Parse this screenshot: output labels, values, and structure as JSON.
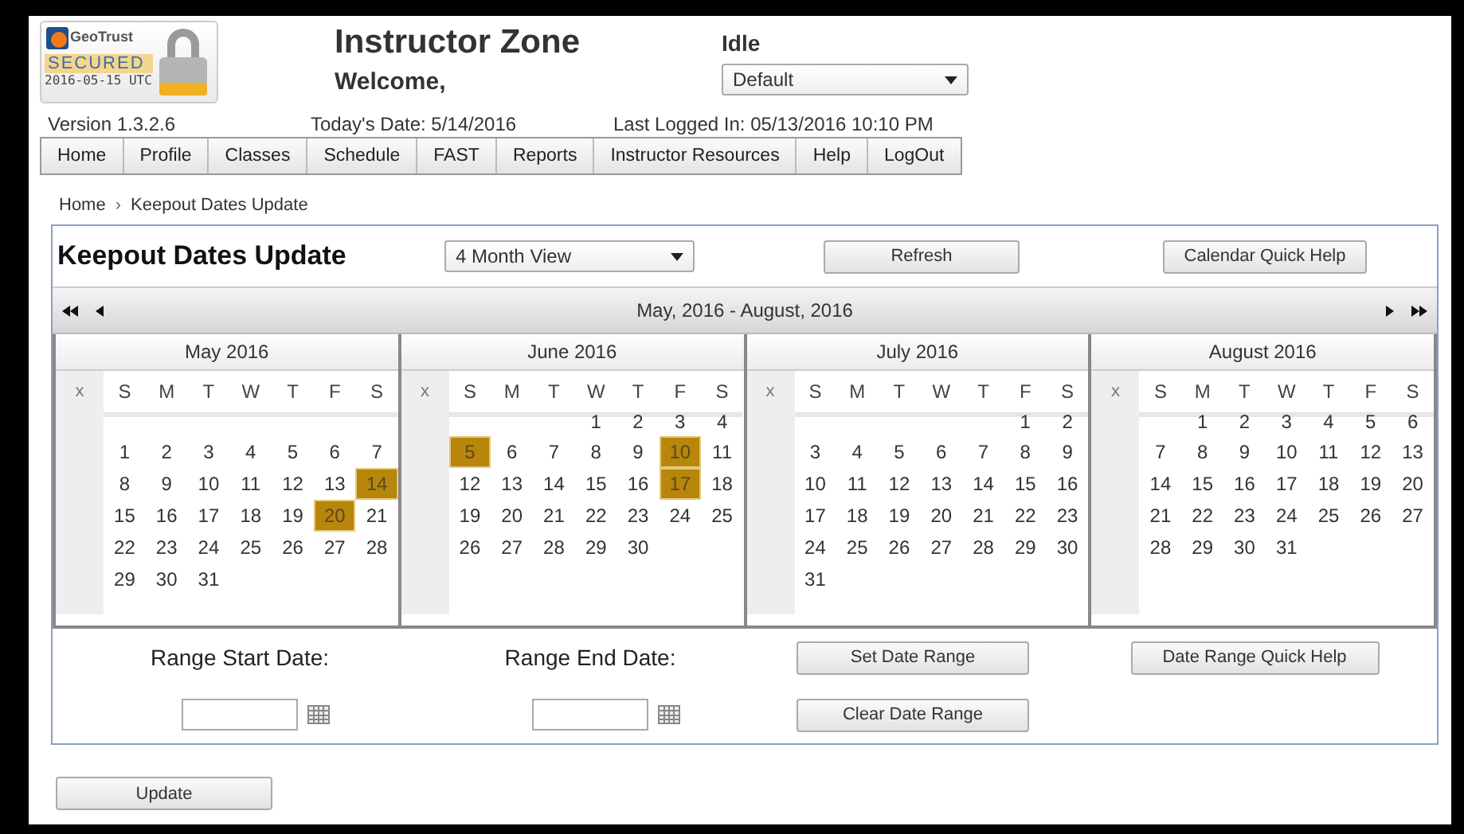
{
  "seal": {
    "brand": "GeoTrust",
    "label": "SECURED",
    "date": "2016-05-15 UTC"
  },
  "app_title": "Instructor Zone",
  "welcome": "Welcome,",
  "status": "Idle",
  "profile_select": {
    "value": "Default"
  },
  "info": {
    "version": "Version 1.3.2.6",
    "today_label": "Today's Date:",
    "today": "5/14/2016",
    "last_label": "Last Logged In:",
    "last": "05/13/2016 10:10 PM"
  },
  "nav": [
    "Home",
    "Profile",
    "Classes",
    "Schedule",
    "FAST",
    "Reports",
    "Instructor Resources",
    "Help",
    "LogOut"
  ],
  "breadcrumb": {
    "items": [
      "Home",
      "Keepout Dates Update"
    ],
    "separator": "›"
  },
  "page_title": "Keepout Dates Update",
  "view_select": {
    "value": "4 Month View"
  },
  "top_buttons": [
    "Refresh",
    "Calendar Quick Help"
  ],
  "calendar": {
    "range": "May, 2016 - August, 2016",
    "months": [
      {
        "title": "May 2016",
        "week_header": "x",
        "weekdays": [
          "S",
          "M",
          "T",
          "W",
          "T",
          "F",
          "S"
        ],
        "weeks": [
          [
            {
              "kind": "blank"
            },
            {
              "kind": "blank"
            },
            {
              "kind": "blank"
            },
            {
              "kind": "blank"
            },
            {
              "kind": "blank"
            },
            {
              "kind": "blank"
            },
            {
              "kind": "blank"
            }
          ],
          [
            {
              "kind": "day",
              "label": "1",
              "selected": false
            },
            {
              "kind": "day",
              "label": "2",
              "selected": false
            },
            {
              "kind": "day",
              "label": "3",
              "selected": false
            },
            {
              "kind": "day",
              "label": "4",
              "selected": false
            },
            {
              "kind": "day",
              "label": "5",
              "selected": false
            },
            {
              "kind": "day",
              "label": "6",
              "selected": false
            },
            {
              "kind": "day",
              "label": "7",
              "selected": false
            }
          ],
          [
            {
              "kind": "day",
              "label": "8",
              "selected": false
            },
            {
              "kind": "day",
              "label": "9",
              "selected": false
            },
            {
              "kind": "day",
              "label": "10",
              "selected": false
            },
            {
              "kind": "day",
              "label": "11",
              "selected": false
            },
            {
              "kind": "day",
              "label": "12",
              "selected": false
            },
            {
              "kind": "day",
              "label": "13",
              "selected": false
            },
            {
              "kind": "day",
              "label": "14",
              "selected": true
            }
          ],
          [
            {
              "kind": "day",
              "label": "15",
              "selected": false
            },
            {
              "kind": "day",
              "label": "16",
              "selected": false
            },
            {
              "kind": "day",
              "label": "17",
              "selected": false
            },
            {
              "kind": "day",
              "label": "18",
              "selected": false
            },
            {
              "kind": "day",
              "label": "19",
              "selected": false
            },
            {
              "kind": "day",
              "label": "20",
              "selected": true
            },
            {
              "kind": "day",
              "label": "21",
              "selected": false
            }
          ],
          [
            {
              "kind": "day",
              "label": "22",
              "selected": false
            },
            {
              "kind": "day",
              "label": "23",
              "selected": false
            },
            {
              "kind": "day",
              "label": "24",
              "selected": false
            },
            {
              "kind": "day",
              "label": "25",
              "selected": false
            },
            {
              "kind": "day",
              "label": "26",
              "selected": false
            },
            {
              "kind": "day",
              "label": "27",
              "selected": false
            },
            {
              "kind": "day",
              "label": "28",
              "selected": false
            }
          ],
          [
            {
              "kind": "day",
              "label": "29",
              "selected": false
            },
            {
              "kind": "day",
              "label": "30",
              "selected": false
            },
            {
              "kind": "day",
              "label": "31",
              "selected": false
            }
          ]
        ]
      },
      {
        "title": "June 2016",
        "week_header": "x",
        "weekdays": [
          "S",
          "M",
          "T",
          "W",
          "T",
          "F",
          "S"
        ],
        "weeks": [
          [
            {
              "kind": "blank"
            },
            {
              "kind": "blank"
            },
            {
              "kind": "blank"
            },
            {
              "kind": "day",
              "label": "1",
              "selected": false
            },
            {
              "kind": "day",
              "label": "2",
              "selected": false
            },
            {
              "kind": "day",
              "label": "3",
              "selected": false
            },
            {
              "kind": "day",
              "label": "4",
              "selected": false
            }
          ],
          [
            {
              "kind": "day",
              "label": "5",
              "selected": true
            },
            {
              "kind": "day",
              "label": "6",
              "selected": false
            },
            {
              "kind": "day",
              "label": "7",
              "selected": false
            },
            {
              "kind": "day",
              "label": "8",
              "selected": false
            },
            {
              "kind": "day",
              "label": "9",
              "selected": false
            },
            {
              "kind": "day",
              "label": "10",
              "selected": true
            },
            {
              "kind": "day",
              "label": "11",
              "selected": false
            }
          ],
          [
            {
              "kind": "day",
              "label": "12",
              "selected": false
            },
            {
              "kind": "day",
              "label": "13",
              "selected": false
            },
            {
              "kind": "day",
              "label": "14",
              "selected": false
            },
            {
              "kind": "day",
              "label": "15",
              "selected": false
            },
            {
              "kind": "day",
              "label": "16",
              "selected": false
            },
            {
              "kind": "day",
              "label": "17",
              "selected": true
            },
            {
              "kind": "day",
              "label": "18",
              "selected": false
            }
          ],
          [
            {
              "kind": "day",
              "label": "19",
              "selected": false
            },
            {
              "kind": "day",
              "label": "20",
              "selected": false
            },
            {
              "kind": "day",
              "label": "21",
              "selected": false
            },
            {
              "kind": "day",
              "label": "22",
              "selected": false
            },
            {
              "kind": "day",
              "label": "23",
              "selected": false
            },
            {
              "kind": "day",
              "label": "24",
              "selected": false
            },
            {
              "kind": "day",
              "label": "25",
              "selected": false
            }
          ],
          [
            {
              "kind": "day",
              "label": "26",
              "selected": false
            },
            {
              "kind": "day",
              "label": "27",
              "selected": false
            },
            {
              "kind": "day",
              "label": "28",
              "selected": false
            },
            {
              "kind": "day",
              "label": "29",
              "selected": false
            },
            {
              "kind": "day",
              "label": "30",
              "selected": false
            }
          ]
        ]
      },
      {
        "title": "July 2016",
        "week_header": "x",
        "weekdays": [
          "S",
          "M",
          "T",
          "W",
          "T",
          "F",
          "S"
        ],
        "weeks": [
          [
            {
              "kind": "blank"
            },
            {
              "kind": "blank"
            },
            {
              "kind": "blank"
            },
            {
              "kind": "blank"
            },
            {
              "kind": "blank"
            },
            {
              "kind": "day",
              "label": "1",
              "selected": false
            },
            {
              "kind": "day",
              "label": "2",
              "selected": false
            }
          ],
          [
            {
              "kind": "day",
              "label": "3",
              "selected": false
            },
            {
              "kind": "day",
              "label": "4",
              "selected": false
            },
            {
              "kind": "day",
              "label": "5",
              "selected": false
            },
            {
              "kind": "day",
              "label": "6",
              "selected": false
            },
            {
              "kind": "day",
              "label": "7",
              "selected": false
            },
            {
              "kind": "day",
              "label": "8",
              "selected": false
            },
            {
              "kind": "day",
              "label": "9",
              "selected": false
            }
          ],
          [
            {
              "kind": "day",
              "label": "10",
              "selected": false
            },
            {
              "kind": "day",
              "label": "11",
              "selected": false
            },
            {
              "kind": "day",
              "label": "12",
              "selected": false
            },
            {
              "kind": "day",
              "label": "13",
              "selected": false
            },
            {
              "kind": "day",
              "label": "14",
              "selected": false
            },
            {
              "kind": "day",
              "label": "15",
              "selected": false
            },
            {
              "kind": "day",
              "label": "16",
              "selected": false
            }
          ],
          [
            {
              "kind": "day",
              "label": "17",
              "selected": false
            },
            {
              "kind": "day",
              "label": "18",
              "selected": false
            },
            {
              "kind": "day",
              "label": "19",
              "selected": false
            },
            {
              "kind": "day",
              "label": "20",
              "selected": false
            },
            {
              "kind": "day",
              "label": "21",
              "selected": false
            },
            {
              "kind": "day",
              "label": "22",
              "selected": false
            },
            {
              "kind": "day",
              "label": "23",
              "selected": false
            }
          ],
          [
            {
              "kind": "day",
              "label": "24",
              "selected": false
            },
            {
              "kind": "day",
              "label": "25",
              "selected": false
            },
            {
              "kind": "day",
              "label": "26",
              "selected": false
            },
            {
              "kind": "day",
              "label": "27",
              "selected": false
            },
            {
              "kind": "day",
              "label": "28",
              "selected": false
            },
            {
              "kind": "day",
              "label": "29",
              "selected": false
            },
            {
              "kind": "day",
              "label": "30",
              "selected": false
            }
          ],
          [
            {
              "kind": "day",
              "label": "31",
              "selected": false
            }
          ]
        ]
      },
      {
        "title": "August 2016",
        "week_header": "x",
        "weekdays": [
          "S",
          "M",
          "T",
          "W",
          "T",
          "F",
          "S"
        ],
        "weeks": [
          [
            {
              "kind": "blank"
            },
            {
              "kind": "day",
              "label": "1",
              "selected": false
            },
            {
              "kind": "day",
              "label": "2",
              "selected": false
            },
            {
              "kind": "day",
              "label": "3",
              "selected": false
            },
            {
              "kind": "day",
              "label": "4",
              "selected": false
            },
            {
              "kind": "day",
              "label": "5",
              "selected": false
            },
            {
              "kind": "day",
              "label": "6",
              "selected": false
            }
          ],
          [
            {
              "kind": "day",
              "label": "7",
              "selected": false
            },
            {
              "kind": "day",
              "label": "8",
              "selected": false
            },
            {
              "kind": "day",
              "label": "9",
              "selected": false
            },
            {
              "kind": "day",
              "label": "10",
              "selected": false
            },
            {
              "kind": "day",
              "label": "11",
              "selected": false
            },
            {
              "kind": "day",
              "label": "12",
              "selected": false
            },
            {
              "kind": "day",
              "label": "13",
              "selected": false
            }
          ],
          [
            {
              "kind": "day",
              "label": "14",
              "selected": false
            },
            {
              "kind": "day",
              "label": "15",
              "selected": false
            },
            {
              "kind": "day",
              "label": "16",
              "selected": false
            },
            {
              "kind": "day",
              "label": "17",
              "selected": false
            },
            {
              "kind": "day",
              "label": "18",
              "selected": false
            },
            {
              "kind": "day",
              "label": "19",
              "selected": false
            },
            {
              "kind": "day",
              "label": "20",
              "selected": false
            }
          ],
          [
            {
              "kind": "day",
              "label": "21",
              "selected": false
            },
            {
              "kind": "day",
              "label": "22",
              "selected": false
            },
            {
              "kind": "day",
              "label": "23",
              "selected": false
            },
            {
              "kind": "day",
              "label": "24",
              "selected": false
            },
            {
              "kind": "day",
              "label": "25",
              "selected": false
            },
            {
              "kind": "day",
              "label": "26",
              "selected": false
            },
            {
              "kind": "day",
              "label": "27",
              "selected": false
            }
          ],
          [
            {
              "kind": "day",
              "label": "28",
              "selected": false
            },
            {
              "kind": "day",
              "label": "29",
              "selected": false
            },
            {
              "kind": "day",
              "label": "30",
              "selected": false
            },
            {
              "kind": "day",
              "label": "31",
              "selected": false
            }
          ]
        ]
      }
    ]
  },
  "range": {
    "start_label": "Range Start Date:",
    "end_label": "Range End Date:",
    "set_button": "Set Date Range",
    "clear_button": "Clear Date Range",
    "help_button": "Date Range Quick Help"
  },
  "update_button": "Update"
}
